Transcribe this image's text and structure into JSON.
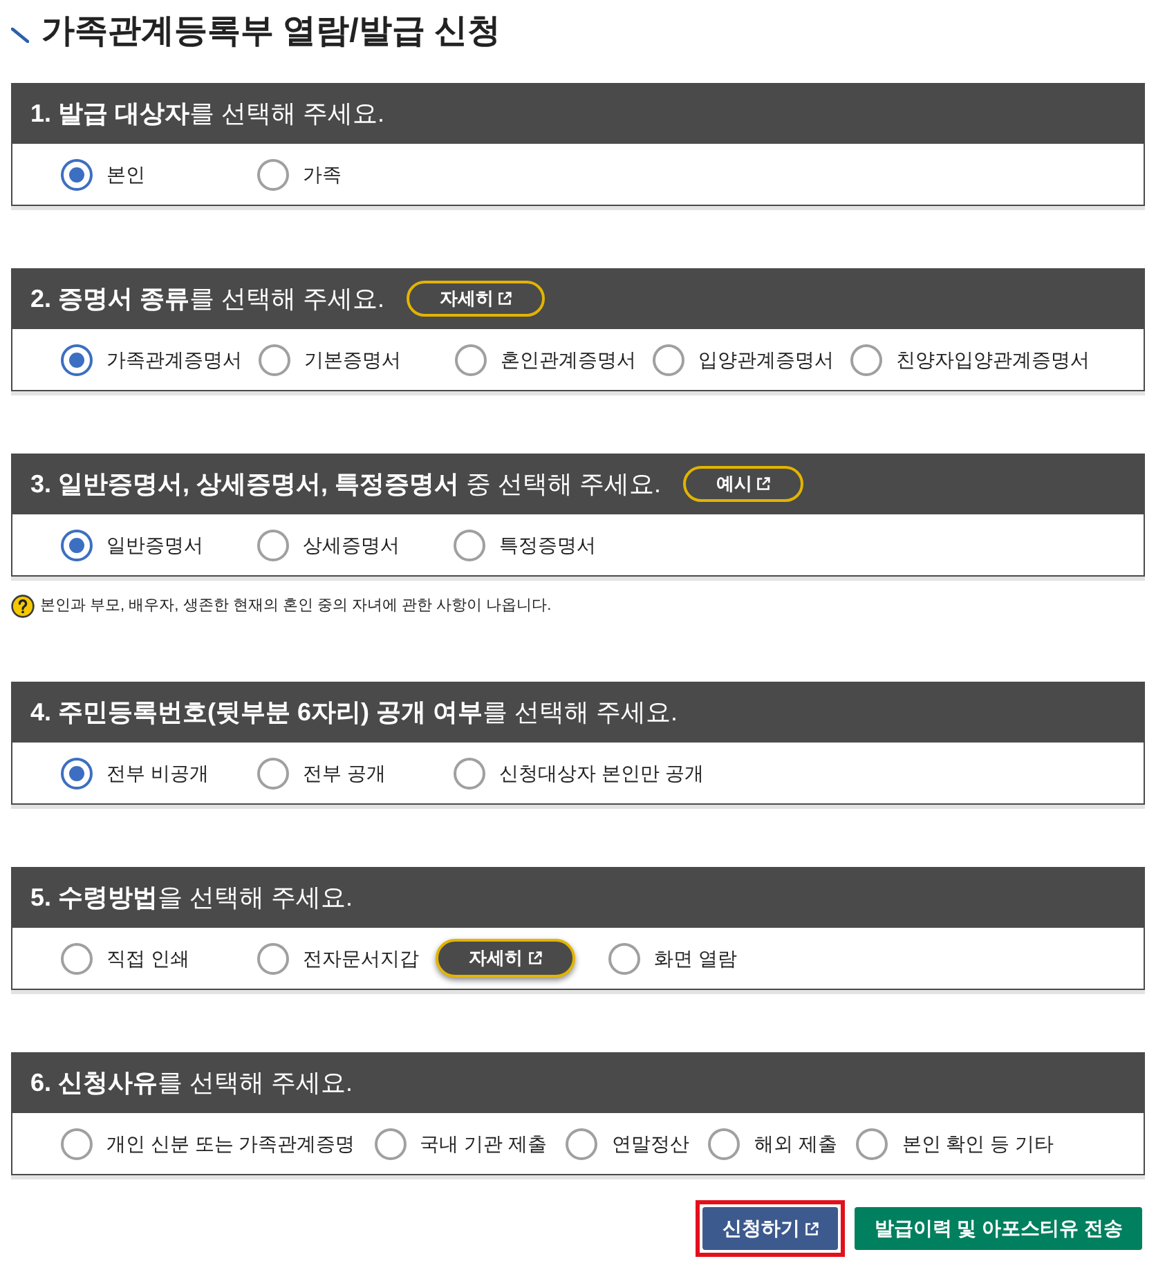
{
  "page": {
    "title": "가족관계등록부 열람/발급 신청"
  },
  "sections": [
    {
      "title": "**1. 발급 대상자**를 선택해 주세요.",
      "options": [
        {
          "label": "본인",
          "selected": true
        },
        {
          "label": "가족",
          "selected": false
        }
      ]
    },
    {
      "title": "**2. 증명서 종류**를 선택해 주세요.",
      "header_button": {
        "label": "자세히"
      },
      "options": [
        {
          "label": "가족관계증명서",
          "selected": true
        },
        {
          "label": "기본증명서",
          "selected": false
        },
        {
          "label": "혼인관계증명서",
          "selected": false
        },
        {
          "label": "입양관계증명서",
          "selected": false
        },
        {
          "label": "친양자입양관계증명서",
          "selected": false
        }
      ]
    },
    {
      "title": "**3. 일반증명서, 상세증명서, 특정증명서** 중 선택해 주세요.",
      "header_button": {
        "label": "예시"
      },
      "options": [
        {
          "label": "일반증명서",
          "selected": true
        },
        {
          "label": "상세증명서",
          "selected": false
        },
        {
          "label": "특정증명서",
          "selected": false
        }
      ],
      "note": "본인과 부모, 배우자, 생존한 현재의 혼인 중의 자녀에 관한 사항이 나옵니다."
    },
    {
      "title": "**4. 주민등록번호(뒷부분 6자리) 공개 여부**를 선택해 주세요.",
      "options": [
        {
          "label": "전부 비공개",
          "selected": true
        },
        {
          "label": "전부 공개",
          "selected": false
        },
        {
          "label": "신청대상자 본인만 공개",
          "selected": false
        }
      ]
    },
    {
      "title": "**5. 수령방법**을 선택해 주세요.",
      "options": [
        {
          "label": "직접 인쇄",
          "selected": false
        },
        {
          "label": "전자문서지갑",
          "selected": false,
          "button": {
            "label": "자세히"
          }
        },
        {
          "label": "화면 열람",
          "selected": false
        }
      ]
    },
    {
      "title": "**6. 신청사유**를 선택해 주세요.",
      "options": [
        {
          "label": "개인 신분 또는 가족관계증명",
          "selected": false
        },
        {
          "label": "국내 기관 제출",
          "selected": false
        },
        {
          "label": "연말정산",
          "selected": false
        },
        {
          "label": "해외 제출",
          "selected": false
        },
        {
          "label": "본인 확인 등 기타",
          "selected": false
        }
      ]
    }
  ],
  "actions": [
    {
      "label": "신청하기",
      "kind": "primary",
      "new_window": true,
      "highlighted": true
    },
    {
      "label": "발급이력 및 아포스티유 전송",
      "kind": "secondary",
      "new_window": false,
      "highlighted": false
    }
  ]
}
